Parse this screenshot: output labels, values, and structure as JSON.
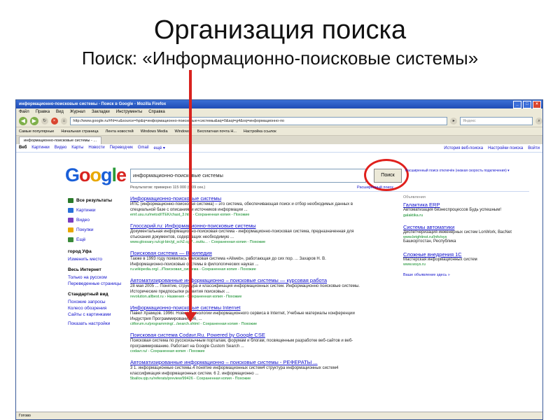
{
  "slide": {
    "title": "Организация поиска",
    "subtitle": "Поиск: «Информационно-поисковые системы»"
  },
  "browser": {
    "title": "информационно-поисковые системы - Поиск в Google - Mozilla Firefox",
    "menu": [
      "Файл",
      "Правка",
      "Вид",
      "Журнал",
      "Закладки",
      "Инструменты",
      "Справка"
    ],
    "url": "http://www.google.ru/#hl=ru&source=hp&q=информационно-поисковые+системы&aq=0&aqi=g4&oq=информационно-по",
    "search_placeholder": "Яндекс",
    "bookmarks": [
      "Самые популярные",
      "Начальная страница",
      "Лента новостей",
      "Windows Media",
      "Windows",
      "Бесплатная почта H...",
      "Настройка ссылок"
    ],
    "tab": "информационно-поисковые системы - ...",
    "status": "Готово"
  },
  "google": {
    "nav": [
      "Веб",
      "Картинки",
      "Видео",
      "Карты",
      "Новости",
      "Переводчик",
      "Gmail",
      "ещё ▾"
    ],
    "nav_right": [
      "История веб-поиска",
      "Настройки поиска",
      "Войти"
    ],
    "logo": [
      "G",
      "o",
      "o",
      "g",
      "l",
      "e"
    ],
    "query": "информационно-поисковые системы",
    "search_button": "Поиск",
    "advanced": "Расширенный поиск отключён (низкая скорость подключения) ▾",
    "results_info": "Результатов: примерно 115 000 (0,09 сек.)",
    "results_info2": "Расширенный поиск",
    "sidebar": {
      "modes": [
        {
          "label": "Все результаты",
          "icon": "all-results-icon",
          "color": "#2a7a2a",
          "active": true
        },
        {
          "label": "Картинки",
          "icon": "images-icon",
          "color": "#2a6fd8",
          "active": false
        },
        {
          "label": "Видео",
          "icon": "video-icon",
          "color": "#7a3fbf",
          "active": false
        },
        {
          "label": "Покупки",
          "icon": "shopping-icon",
          "color": "#e8a800",
          "active": false
        },
        {
          "label": "Ещё",
          "icon": "more-icon",
          "color": "#3a8a3a",
          "active": false
        }
      ],
      "city_label": "город Уфа",
      "change_place": "Изменить место",
      "all_internet": "Весь Интернет",
      "russian_only": "Только на русском",
      "translated": "Переведенные страницы",
      "standard_view": "Стандартный вид",
      "similar": "Похожие запросы",
      "wheel": "Колесо обозрения",
      "with_images": "Сайты с картинками",
      "show_tools": "Показать настройки"
    },
    "results": [
      {
        "title": "Информационно-поисковые системы",
        "snippet": "ИПС (информационно-поисковая система) – это система, обеспечивающая поиск и отбор необходимых данных в специальной базе с описаниями источников информации ...",
        "url": "emf.usu.ru/metod/ITEK/chast_3.htm - Сохраненная копия - Похожие"
      },
      {
        "title": "Глоссарий.ru: Информационно-поисковые системы",
        "snippet": "Документальная информационно-поисковая система - информационно-поисковая система, предназначенная для отыскания документов, содержащих необходимую ...",
        "url": "www.glossary.ru/cgi-bin/gl_sch2.cgi?...outtu... - Сохраненная копия - Похожие"
      },
      {
        "title": "Поисковая система — Википедия",
        "snippet": "Также в 1993 году появилась поисковая система «Aliweb», работающая до сих пор. ... Захаров Н. В. Информационно-поисковые системы в филологических науках ...",
        "url": "ru.wikipedia.org/.../Поисковая_система - Сохраненная копия - Похожие"
      },
      {
        "title": "Автоматизированные информационно – поисковые системы — курсовая работа",
        "snippet": "28 мая 2005 ... Понятие, структура и классификация информационных систем. Информационно поисковые системы. Исторические предпосылки развития поисковых ...",
        "url": "revolution.allbest.ru › Назвения - Сохраненная копия - Похожие"
      },
      {
        "title": "Информационно-поисковые системы Internet",
        "snippet": "Павел Храмцов. 1996г. Новые технологии информационного сервиса в Internet, Учебные материалы конференции Индустрия Программирования 96, ...",
        "url": "citforum.ru/programming/.../search.shtml - Сохраненная копия - Похожие"
      },
      {
        "title": "Поисковая система Codavr.Ru. Powered by Google CSE",
        "snippet": "Поисковая система по русскоязычным порталам, форумам и блогам, посвященным разработке веб-сайтов и веб-программированию. Работает на Google Custom Search ...",
        "url": "codavr.ru/ - Сохраненная копия - Похожие"
      },
      {
        "title": "Автоматизированные информационно – поисковые системы - РЕФЕРАТЫ ...",
        "snippet": "3 1. информационные системы.4 понятие информационных систем4 структура информационных систем4 классификация информационных систем. 6 2. информационно ...",
        "url": "5ballov.qip.ru/referats/preview/99426 - Сохраненная копия - Похожие"
      }
    ],
    "ads": {
      "heading": "Объявления",
      "items": [
        {
          "title": "Галактика ERP",
          "text": "Автоматизация бизнеспроцессов Будь успешным!",
          "url": "galaktika.ru"
        },
        {
          "title": "Системы автоматики",
          "text": "Диспетчеризация инженерных систем LonWork, BacNet",
          "url": "www.brightinst.ru/Info/sys",
          "extra": "Башкортостан, Республика"
        },
        {
          "title": "Сложные внедрения 1С",
          "text": "Мастерская информационных систем",
          "url": "www.wsys.ru"
        }
      ],
      "more": "Ваше объявление здесь »"
    }
  }
}
